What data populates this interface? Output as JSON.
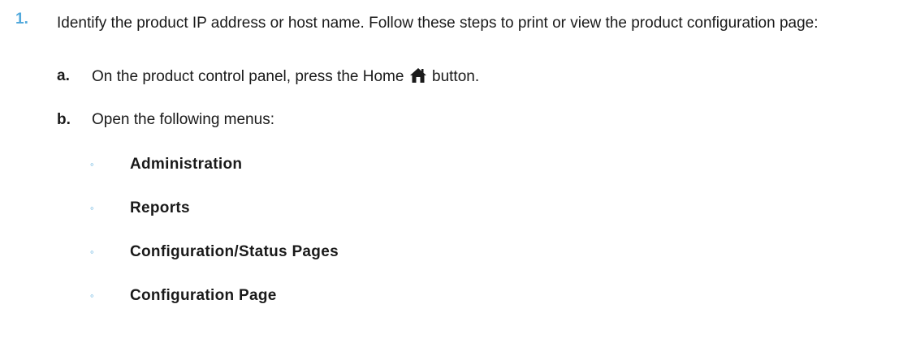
{
  "step": {
    "number": "1.",
    "text": "Identify the product IP address or host name. Follow these steps to print or view the product configuration page:"
  },
  "substeps": {
    "a": {
      "letter": "a.",
      "text_before": "On the product control panel, press the Home",
      "icon": "home-icon",
      "text_after": "button."
    },
    "b": {
      "letter": "b.",
      "text": "Open the following menus:"
    }
  },
  "menus": [
    "Administration",
    "Reports",
    "Configuration/Status Pages",
    "Configuration Page"
  ],
  "colors": {
    "accent": "#52a9dc",
    "text": "#1a1a1a"
  }
}
